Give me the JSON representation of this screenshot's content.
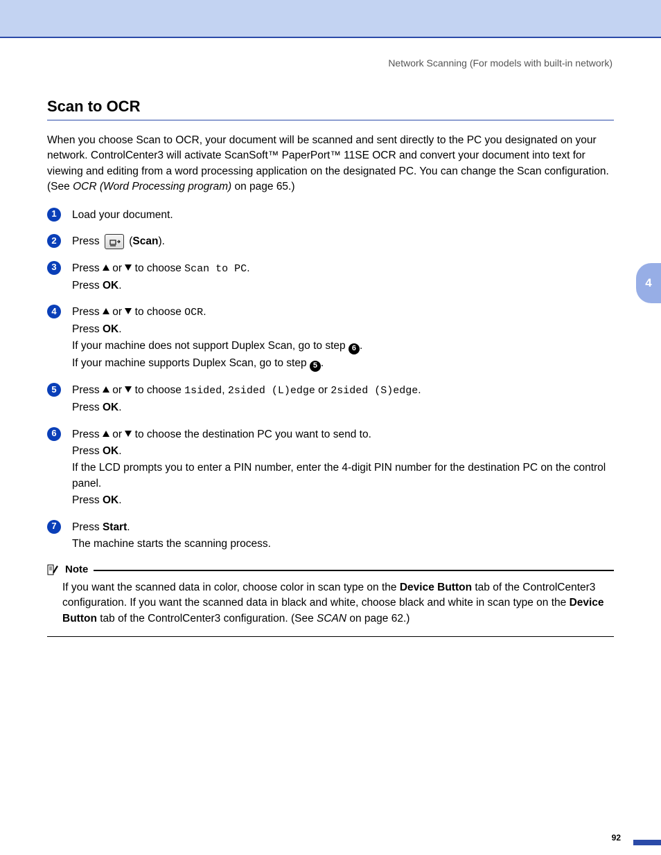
{
  "header": {
    "running_head": "Network Scanning (For models with built-in network)"
  },
  "section": {
    "title": "Scan to OCR",
    "intro_pre": "When you choose Scan to OCR, your document will be scanned and sent directly to the PC you designated on your network. ControlCenter3 will activate ScanSoft™ PaperPort™ 11SE OCR and convert your document into text for viewing and editing from a word processing application on the designated PC. You can change the Scan configuration. (See ",
    "intro_xref": "OCR (Word Processing program)",
    "intro_post": " on page 65.)"
  },
  "steps": {
    "s1": {
      "a": "Load your document."
    },
    "s2": {
      "a": "Press ",
      "b": " (",
      "c": "Scan",
      "d": ")."
    },
    "s3": {
      "a": "Press ",
      "b": " or ",
      "c": " to choose ",
      "m": "Scan to PC",
      "d": ".",
      "e": "Press ",
      "f": "OK",
      "g": "."
    },
    "s4": {
      "a": "Press ",
      "b": " or ",
      "c": " to choose ",
      "m": "OCR",
      "d": ".",
      "e": "Press ",
      "f": "OK",
      "g": ".",
      "h": "If your machine does not support Duplex Scan, go to step ",
      "i": ".",
      "j": "If your machine supports Duplex Scan, go to step ",
      "k": "."
    },
    "s5": {
      "a": "Press ",
      "b": " or ",
      "c": " to choose ",
      "m1": "1sided",
      "p1": ", ",
      "m2": "2sided (L)edge",
      "p2": " or ",
      "m3": "2sided (S)edge",
      "d": ".",
      "e": "Press ",
      "f": "OK",
      "g": "."
    },
    "s6": {
      "a": "Press ",
      "b": " or ",
      "c": " to choose the destination PC you want to send to.",
      "e": "Press ",
      "f": "OK",
      "g": ".",
      "h": "If the LCD prompts you to enter a PIN number, enter the 4-digit PIN number for the destination PC on the control panel.",
      "i": "Press ",
      "j": "OK",
      "k": "."
    },
    "s7": {
      "a": "Press ",
      "b": "Start",
      "c": ".",
      "d": "The machine starts the scanning process."
    }
  },
  "refs": {
    "r6": "6",
    "r5": "5"
  },
  "note": {
    "title": "Note",
    "body_a": "If you want the scanned data in color, choose color in scan type on the ",
    "body_b": "Device Button",
    "body_c": " tab of the ControlCenter3 configuration. If you want the scanned data in black and white, choose black and white in scan type on the ",
    "body_d": "Device Button",
    "body_e": " tab of the ControlCenter3 configuration. (See ",
    "body_f": "SCAN",
    "body_g": " on page 62.)"
  },
  "sidebar": {
    "chapter": "4"
  },
  "footer": {
    "page": "92"
  }
}
